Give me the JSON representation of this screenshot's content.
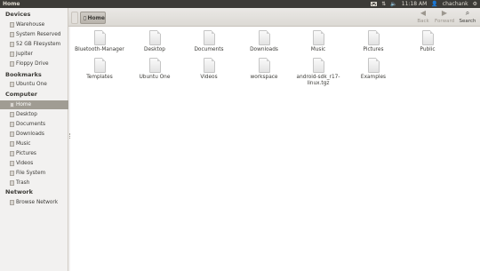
{
  "topbar": {
    "title": "Home",
    "time": "11:18 AM",
    "user": "chachank"
  },
  "toolbar": {
    "crumb_label": "Home",
    "back_label": "Back",
    "forward_label": "Forward",
    "search_label": "Search"
  },
  "sidebar": {
    "devices_heading": "Devices",
    "devices": [
      "Warehouse",
      "System Reserved",
      "52 GB Filesystem",
      "Jupiter",
      "Floppy Drive"
    ],
    "bookmarks_heading": "Bookmarks",
    "bookmarks": [
      "Ubuntu One"
    ],
    "computer_heading": "Computer",
    "computer": [
      "Home",
      "Desktop",
      "Documents",
      "Downloads",
      "Music",
      "Pictures",
      "Videos",
      "File System",
      "Trash"
    ],
    "network_heading": "Network",
    "network": [
      "Browse Network"
    ]
  },
  "files": {
    "row1": [
      "Bluetooth-Manager",
      "Desktop",
      "Documents",
      "Downloads",
      "Music",
      "Pictures",
      "Public"
    ],
    "row2": [
      "Templates",
      "Ubuntu One",
      "Videos",
      "workspace",
      "android-sdk_r17-",
      "linux.tgz",
      "Examples"
    ]
  },
  "colors": {
    "panel": "#3c3b37",
    "selected_sidebar": "#a09c93",
    "window_bg": "#f2f1f0"
  }
}
